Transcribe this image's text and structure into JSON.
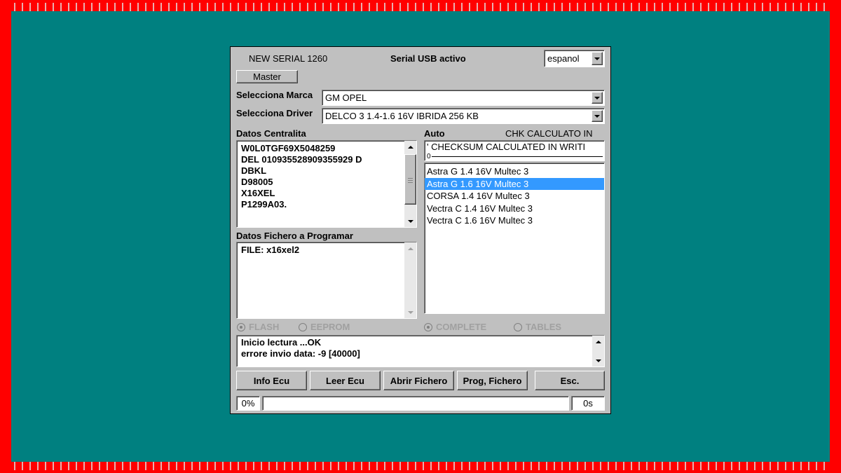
{
  "window": {
    "device_title": "NEW SERIAL 1260",
    "usb_status": "Serial USB activo",
    "language": "espanol",
    "master_button": "Master"
  },
  "selectors": {
    "marca_label": "Selecciona Marca",
    "marca_value": "GM OPEL",
    "driver_label": "Selecciona Driver",
    "driver_value": "DELCO 3 1.4-1.6 16V   IBRIDA 256 KB"
  },
  "centralita": {
    "label": "Datos Centralita",
    "lines": [
      "W0L0TGF69X5048259",
      "DEL  010935528909355929 D",
      "DBKL",
      "D98005",
      "X16XEL",
      "P1299A03."
    ]
  },
  "auto": {
    "label": "Auto",
    "chk_status": "CHK CALCULATO IN",
    "checksum_line": "' CHECKSUM CALCULATED IN WRITI",
    "slider_value": "0",
    "models": [
      "Astra G  1.4 16V Multec 3",
      "Astra G  1.6 16V Multec 3",
      "CORSA 1.4 16V Multec 3",
      "Vectra C 1.4 16V Multec 3",
      "Vectra C 1.6 16V Multec 3"
    ],
    "selected_index": 1
  },
  "fichero": {
    "label": "Datos Fichero a Programar",
    "lines": [
      "FILE: x16xel2"
    ]
  },
  "options": {
    "flash": "FLASH",
    "eeprom": "EEPROM",
    "complete": "COMPLETE",
    "tables": "TABLES"
  },
  "log": {
    "lines": [
      "Inicio lectura ...OK",
      "errore invio data: -9 [40000]"
    ]
  },
  "buttons": {
    "info_ecu": "Info Ecu",
    "leer_ecu": "Leer Ecu",
    "abrir_fichero": "Abrir Fichero",
    "prog_fichero": "Prog, Fichero",
    "esc": "Esc."
  },
  "status": {
    "progress_percent": "0%",
    "progress_fraction": 0,
    "elapsed": "0s"
  }
}
